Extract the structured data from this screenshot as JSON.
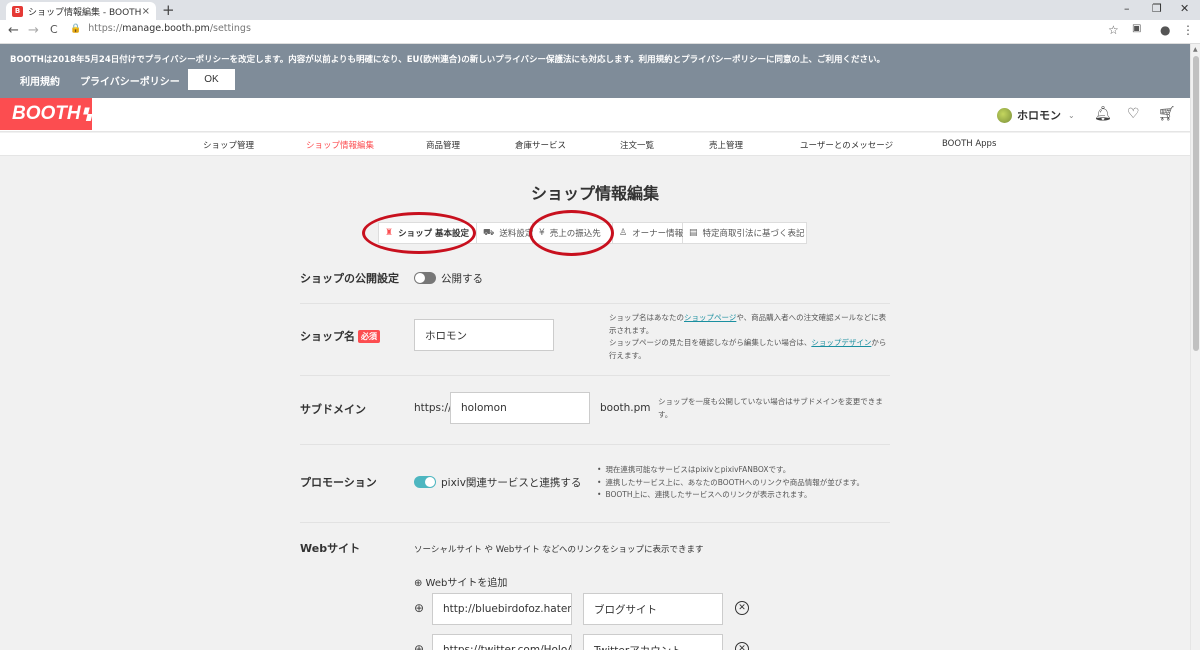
{
  "browser": {
    "tab_title": "ショップ情報編集 - BOOTH",
    "tab_close": "×",
    "new_tab": "+",
    "minimize": "–",
    "restore": "❐",
    "close": "✕",
    "back": "←",
    "forward": "→",
    "reload": "C",
    "url_prefix": "https://",
    "url_host": "manage.booth.pm",
    "url_path": "/settings"
  },
  "notice": {
    "text": "BOOTHは2018年5月24日付けでプライバシーポリシーを改定します。内容が以前よりも明確になり、EU(欧州連合)の新しいプライバシー保護法にも対応します。利用規約とプライバシーポリシーに同意の上、ご利用ください。",
    "terms_link": "利用規約",
    "privacy_link": "プライバシーポリシー",
    "ok_label": "OK"
  },
  "header": {
    "logo": "BOOTH",
    "user_name": "ホロモン"
  },
  "nav": {
    "items": [
      "ショップ管理",
      "ショップ情報編集",
      "商品管理",
      "倉庫サービス",
      "注文一覧",
      "売上管理",
      "ユーザーとのメッセージ",
      "BOOTH Apps"
    ]
  },
  "page": {
    "title": "ショップ情報編集"
  },
  "tabs": [
    "ショップ 基本設定",
    "送料設定",
    "売上の振込先",
    "オーナー情報",
    "特定商取引法に基づく表記"
  ],
  "form": {
    "public": {
      "label": "ショップの公開設定",
      "toggle_label": "公開する",
      "enabled": false
    },
    "name": {
      "label": "ショップ名",
      "required": "必須",
      "value": "ホロモン",
      "help_1": "ショップ名はあなたの",
      "help_link_1": "ショップページ",
      "help_2": "や、商品購入者への注文確認メールなどに表示されます。",
      "help_3": "ショップページの見た目を確認しながら編集したい場合は、",
      "help_link_2": "ショップデザイン",
      "help_4": "から行えます。"
    },
    "subdomain": {
      "label": "サブドメイン",
      "prefix": "https://",
      "value": "holomon",
      "suffix": "booth.pm",
      "help": "ショップを一度も公開していない場合はサブドメインを変更できます。"
    },
    "promotion": {
      "label": "プロモーション",
      "toggle_label": "pixiv関連サービスと連携する",
      "enabled": true,
      "bullets": [
        "現在連携可能なサービスはpixivとpixivFANBOXです。",
        "連携したサービス上に、あなたのBOOTHへのリンクや商品情報が並びます。",
        "BOOTH上に、連携したサービスへのリンクが表示されます。"
      ]
    },
    "website": {
      "label": "Webサイト",
      "description": "ソーシャルサイト や Webサイト などへのリンクをショップに表示できます",
      "add_label": "⊕ Webサイトを追加",
      "links": [
        {
          "url": "http://bluebirdofoz.hatenab",
          "name": "ブログサイト"
        },
        {
          "url": "https://twitter.com/HoloAdv",
          "name": "Twitterアカウント"
        }
      ]
    }
  },
  "colors": {
    "brand": "#fc4d50",
    "notice_bg": "#7f8c99",
    "toggle_on": "#4db6c0",
    "annotation_circle": "#c8101e"
  }
}
